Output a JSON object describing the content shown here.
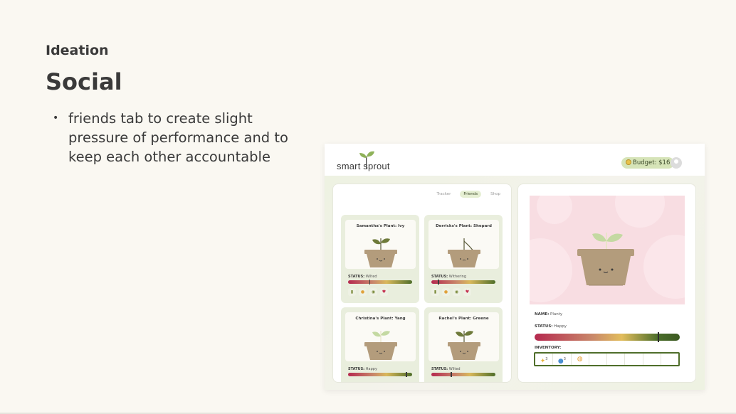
{
  "slide": {
    "eyebrow": "Ideation",
    "title": "Social",
    "bullets": [
      "friends tab to create slight pressure of performance and to keep each other accountable"
    ]
  },
  "app": {
    "logo_text": "smart sprout",
    "budget": "Budget: $16",
    "tabs": [
      {
        "label": "Tracker",
        "active": false
      },
      {
        "label": "Friends",
        "active": true
      },
      {
        "label": "Shop",
        "active": false
      }
    ],
    "friend_cards": [
      {
        "name": "Samantha's Plant: Ivy",
        "status_label": "STATUS:",
        "status": "Wilted",
        "health": 0.33
      },
      {
        "name": "Derricks's Plant: Shepard",
        "status_label": "STATUS:",
        "status": "Withering",
        "health": 0.1
      },
      {
        "name": "Christina's Plant: Yang",
        "status_label": "STATUS:",
        "status": "Happy",
        "health": 0.9
      },
      {
        "name": "Rachel's Plant: Greene",
        "status_label": "STATUS:",
        "status": "Wilted",
        "health": 0.3
      }
    ],
    "detail": {
      "name_label": "NAME:",
      "name": "Planty",
      "status_label": "STATUS:",
      "status": "Happy",
      "health": 0.85,
      "inventory_label": "INVENTORY:",
      "inventory": [
        {
          "icon": "sparkle-icon",
          "count": "3"
        },
        {
          "icon": "water-drop-icon",
          "count": "3"
        },
        {
          "icon": "sun-face-icon",
          "count": ""
        }
      ]
    }
  },
  "colors": {
    "background": "#faf8f2",
    "accent_green": "#4f6e2a",
    "hero_pink": "#f8dde2"
  }
}
